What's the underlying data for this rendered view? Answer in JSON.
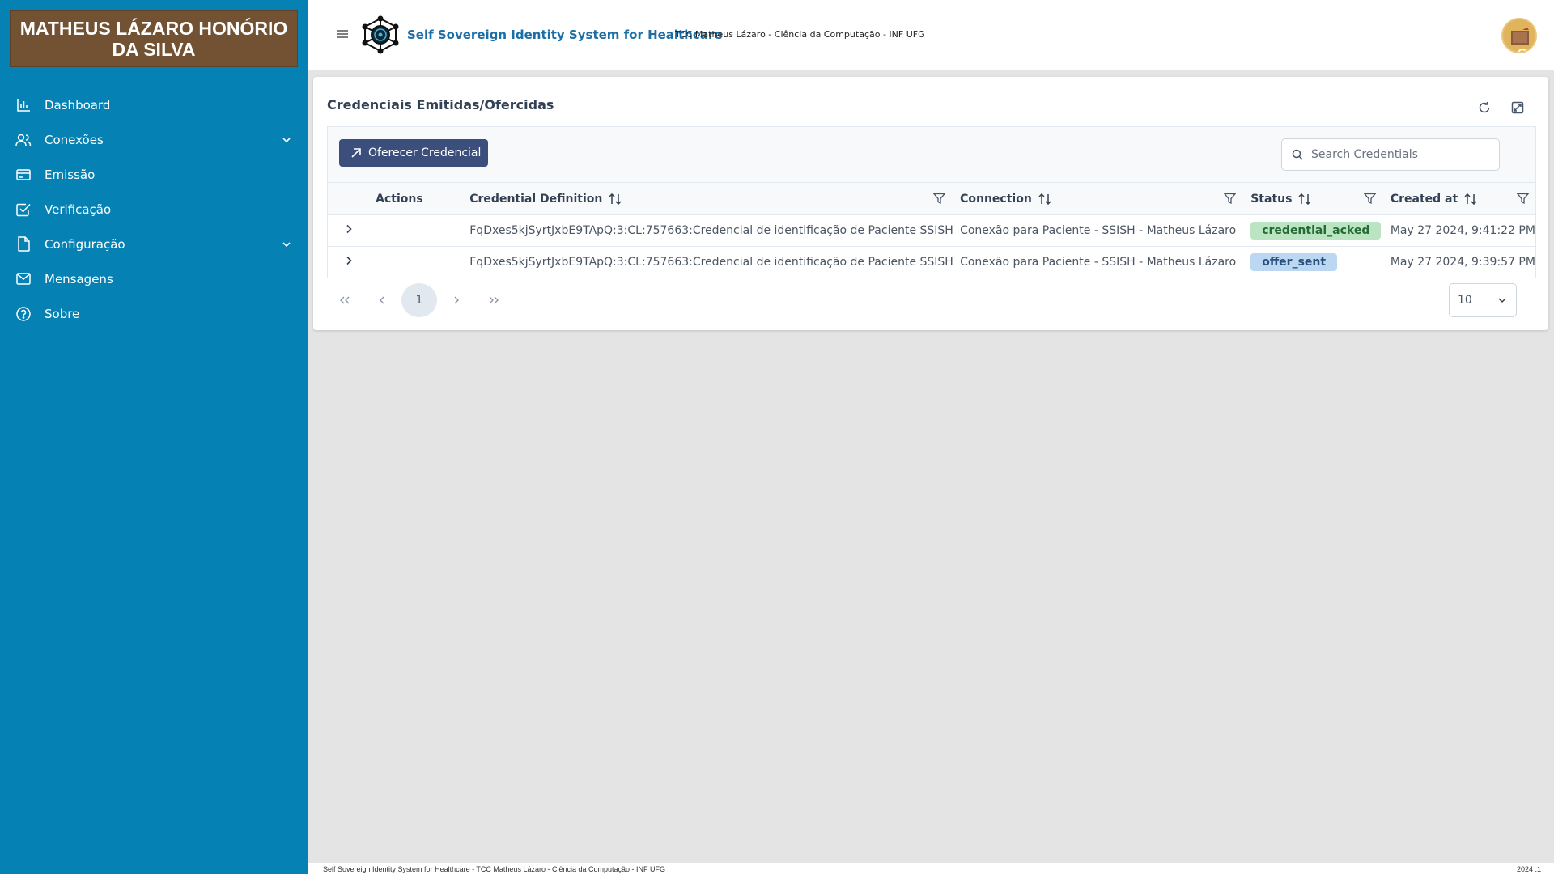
{
  "sidebar": {
    "brand": "MATHEUS LÁZARO HONÓRIO DA SILVA",
    "items": [
      {
        "label": "Dashboard",
        "icon": "chart-bar-icon"
      },
      {
        "label": "Conexões",
        "icon": "users-icon",
        "has_submenu": true
      },
      {
        "label": "Emissão",
        "icon": "credit-card-icon"
      },
      {
        "label": "Verificação",
        "icon": "check-square-icon"
      },
      {
        "label": "Configuração",
        "icon": "file-icon",
        "has_submenu": true
      },
      {
        "label": "Mensagens",
        "icon": "envelope-icon"
      },
      {
        "label": "Sobre",
        "icon": "question-circle-icon"
      }
    ]
  },
  "topbar": {
    "title": "Self Sovereign Identity System for Healthcare",
    "subtitle": "TCC Matheus Lázaro - Ciência da Computação - INF UFG"
  },
  "card": {
    "title": "Credenciais Emitidas/Ofercidas",
    "offer_button": "Oferecer Credencial",
    "search_placeholder": "Search Credentials",
    "columns": [
      "Actions",
      "Credential Definition",
      "Connection",
      "Status",
      "Created at"
    ],
    "rows": [
      {
        "credential_definition": "FqDxes5kjSyrtJxbE9TApQ:3:CL:757663:Credencial de identificação de Paciente SSISH",
        "connection": "Conexão para Paciente - SSISH - Matheus Lázaro",
        "status": "credential_acked",
        "created_at": "May 27 2024, 9:41:22 PM"
      },
      {
        "credential_definition": "FqDxes5kjSyrtJxbE9TApQ:3:CL:757663:Credencial de identificação de Paciente SSISH",
        "connection": "Conexão para Paciente - SSISH - Matheus Lázaro",
        "status": "offer_sent",
        "created_at": "May 27 2024, 9:39:57 PM"
      }
    ],
    "pagination": {
      "current_page": "1",
      "rows_per_page": "10"
    }
  },
  "footer": {
    "left": "Self Sovereign Identity System for Healthcare - TCC Matheus Lázaro - Ciência da Computação - INF UFG",
    "right": "2024 .1"
  },
  "colors": {
    "sidebar_bg": "#0581b4",
    "brand_bg": "#735233",
    "primary_button": "#3b4e7c",
    "status_acked": "#bbe5c2",
    "status_offer": "#bcd7f2"
  }
}
